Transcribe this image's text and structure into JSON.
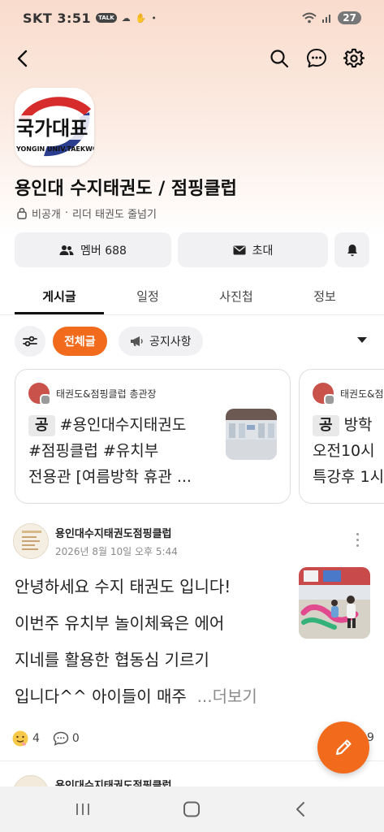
{
  "status_bar": {
    "carrier": "SKT",
    "time": "3:51",
    "talk_badge": "TALK",
    "battery": "27"
  },
  "header": {
    "back_icon": "arrow-left-icon",
    "search_icon": "search-icon",
    "chat_icon": "chat-bubble-icon",
    "settings_icon": "gear-icon"
  },
  "club": {
    "avatar_text": "국가대표",
    "avatar_subtext": "YONGIN UNIV.TAEKWO",
    "title": "용인대 수지태권도 / 점핑클럽",
    "visibility": "비공개",
    "separator": "·",
    "leader": "리더 태권도 줄넘기"
  },
  "actions": {
    "members_label": "멤버 688",
    "invite_label": "초대",
    "bell_icon": "bell-icon"
  },
  "tabs": [
    "게시글",
    "일정",
    "사진첩",
    "정보"
  ],
  "filters": {
    "filter_icon": "sliders-icon",
    "all_label": "전체글",
    "notice_label": "공지사항",
    "megaphone_icon": "megaphone-icon"
  },
  "notice_cards": [
    {
      "author": "태권도&점핑클럽 총관장",
      "badge": "공",
      "line1": "#용인대수지태권도",
      "line2": "#점핑클럽 #유치부",
      "line3": "전용관 [여름방학 휴관 ..."
    },
    {
      "author": "태권도&점핑",
      "badge": "공",
      "line1": "방학",
      "line2": "오전10시",
      "line3": "특강후 1시"
    }
  ],
  "post": {
    "author": "용인대수지태권도점핑클럽",
    "date": "2026년 8월 10일 오후 5:44",
    "text_lines": [
      "안녕하세요 수지 태권도 입니다!",
      "이번주 유치부 놀이체육은 에어",
      "지네를 활용한 협동심 기르기",
      "입니다^^ 아이들이 매주"
    ],
    "more_label": "...더보기",
    "reaction_count": "4",
    "comment_count": "0",
    "edge_count": "9"
  },
  "post2": {
    "author": "용인대수지태권도점핑클럽"
  },
  "colors": {
    "accent": "#f26a1b",
    "header_gradient_top": "#f9dccd",
    "chip_bg": "#f1f1f3"
  }
}
